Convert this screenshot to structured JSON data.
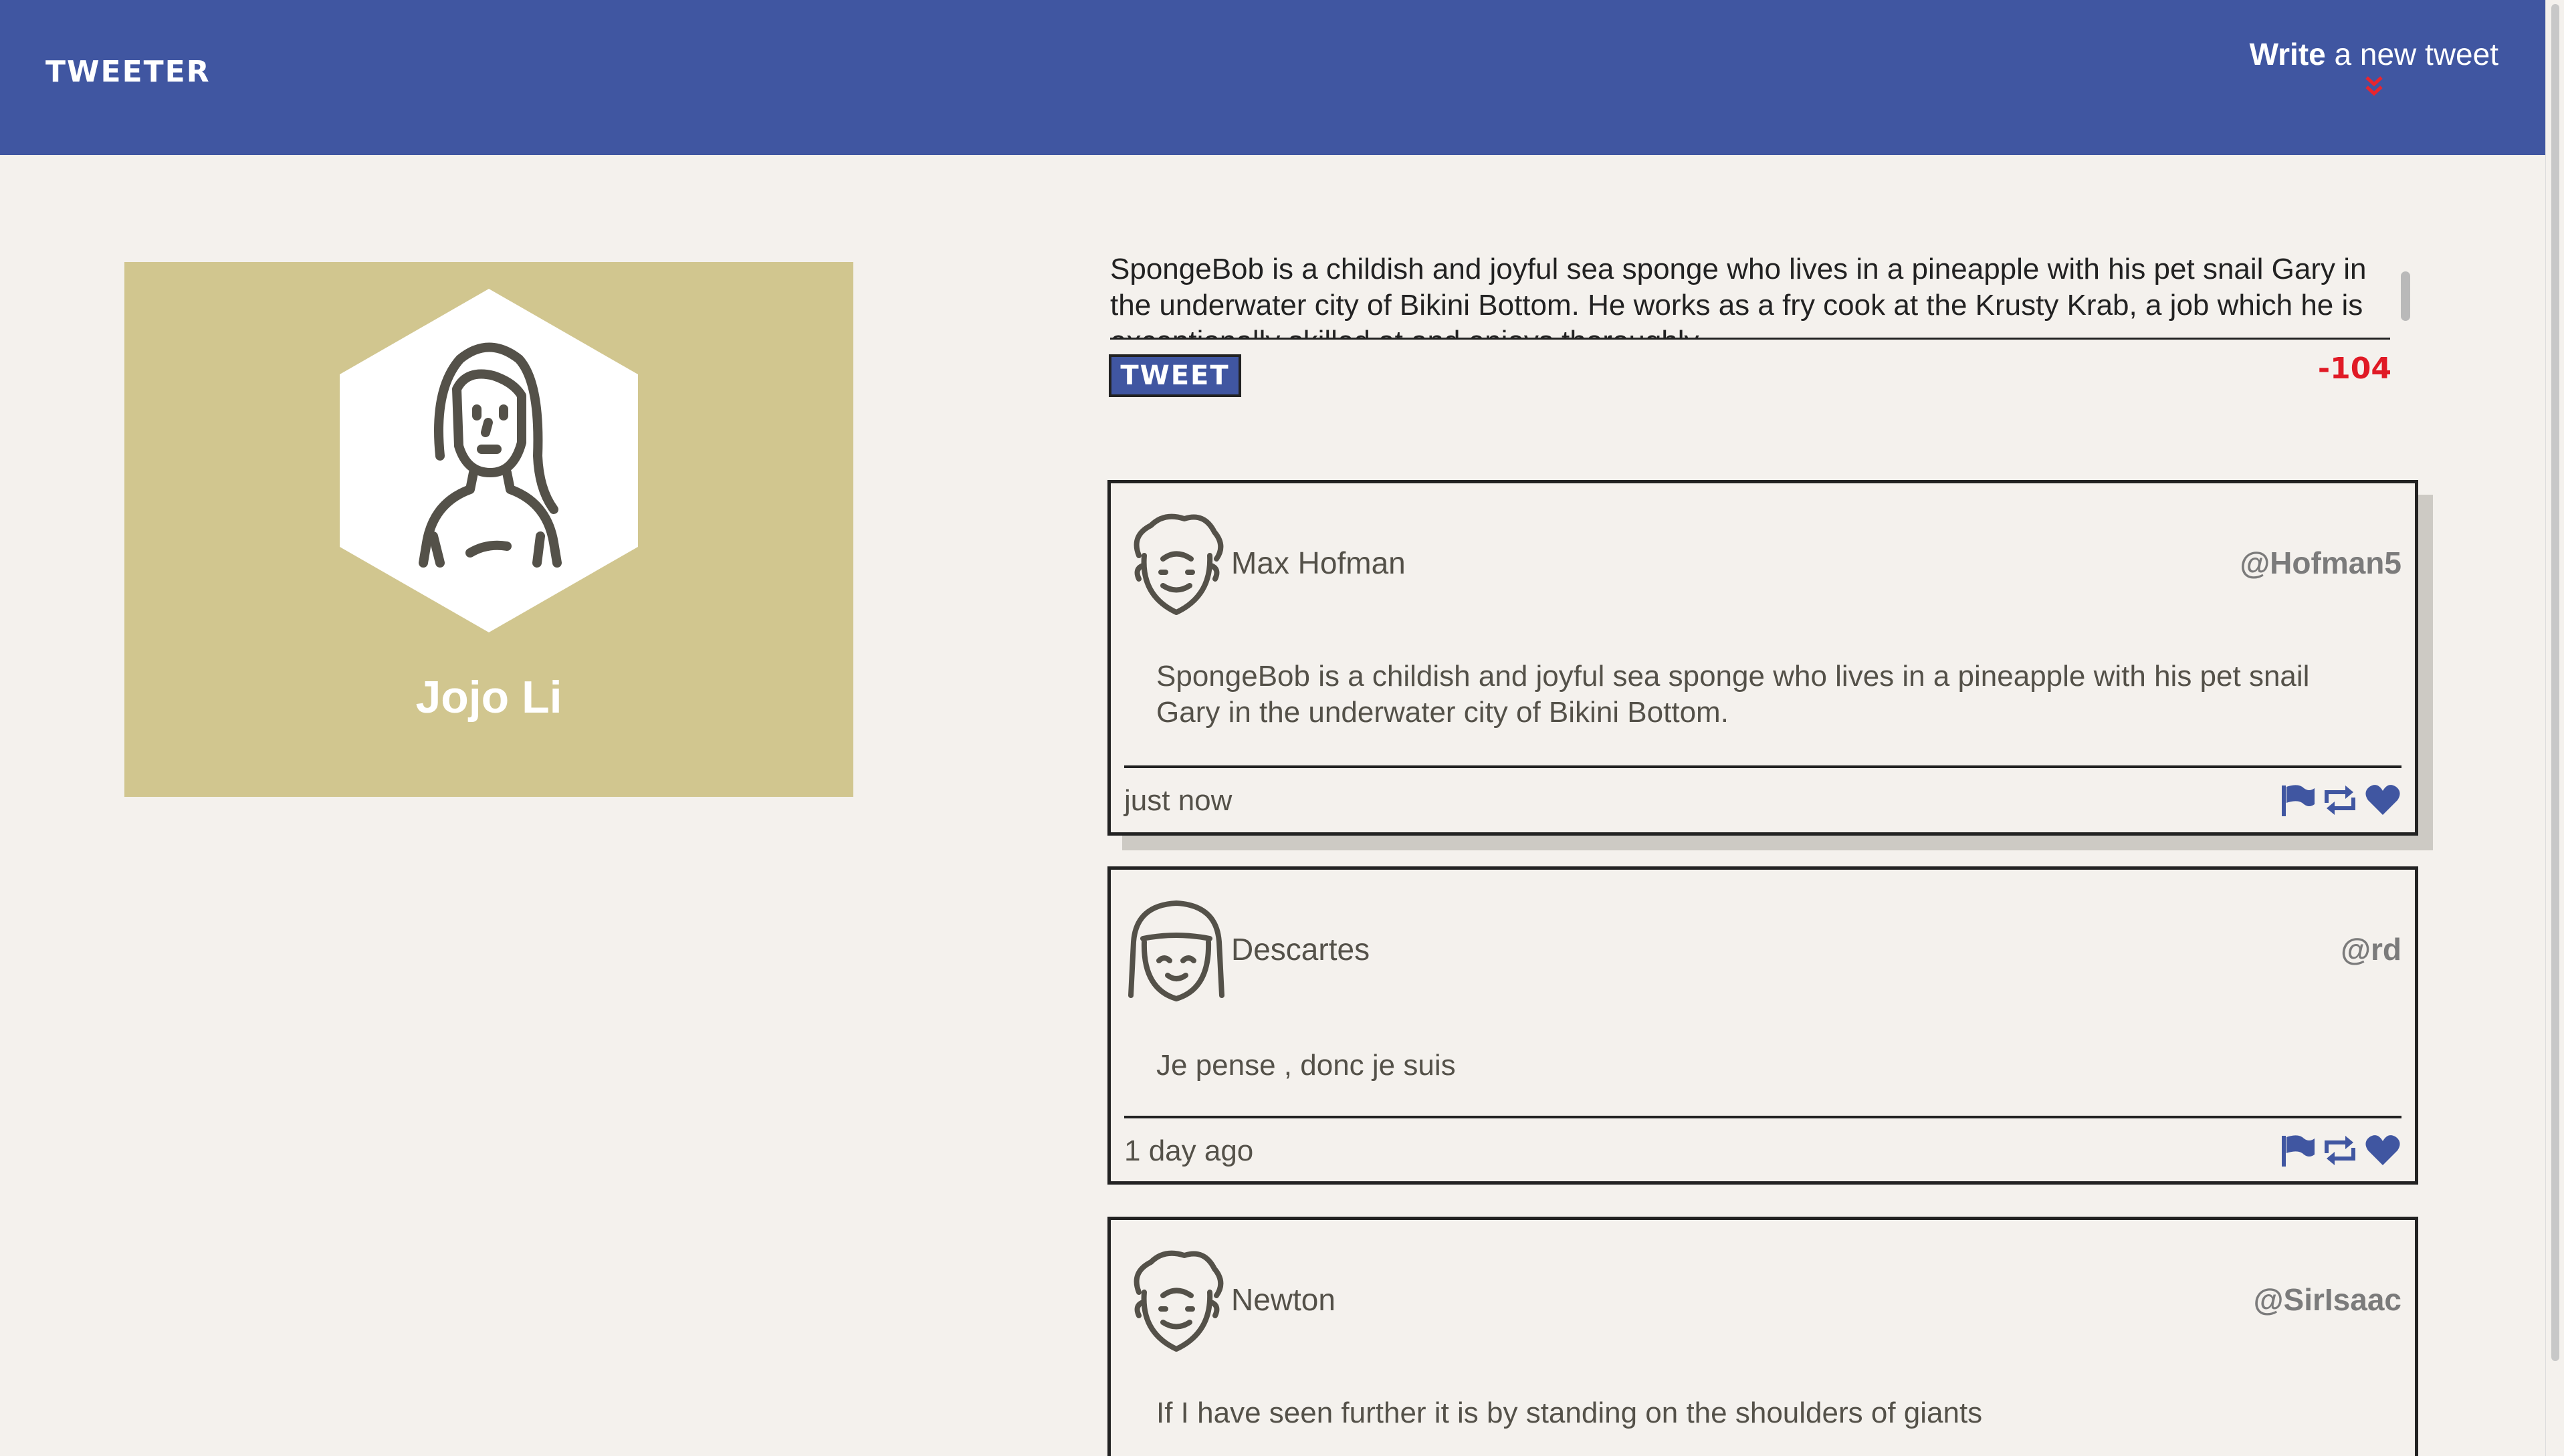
{
  "nav": {
    "brand": "TWEETER",
    "write_bold": "Write",
    "write_rest": " a new tweet",
    "write_chevron": "˅"
  },
  "profile": {
    "name": "Jojo Li",
    "avatar_icon": "female-avatar-icon"
  },
  "compose": {
    "text": "SpongeBob is a childish and joyful sea sponge who lives in a pineapple with his pet snail Gary in the underwater city of Bikini Bottom. He works as a fry cook at the Krusty Krab, a job which he is exceptionally skilled at and enjoys thoroughly.",
    "button_label": "TWEET",
    "counter": "-104"
  },
  "tweets": [
    {
      "name": "Max Hofman",
      "handle": "@Hofman5",
      "content": "SpongeBob is a childish and joyful sea sponge who lives in a pineapple with his pet snail Gary in the underwater city of Bikini Bottom.",
      "time": "just now",
      "avatar_icon": "curly-hair-avatar-icon"
    },
    {
      "name": "Descartes",
      "handle": "@rd",
      "content": "Je pense , donc je suis",
      "time": "1 day ago",
      "avatar_icon": "bangs-avatar-icon"
    },
    {
      "name": "Newton",
      "handle": "@SirIsaac",
      "content": "If I have seen further it is by standing on the shoulders of giants",
      "time": "",
      "avatar_icon": "curly-hair-avatar-icon"
    }
  ],
  "colors": {
    "nav_bg": "#4056a1",
    "profile_bg": "#d1c68f",
    "page_bg": "#f4f1ed",
    "accent_red": "#e01a25"
  }
}
